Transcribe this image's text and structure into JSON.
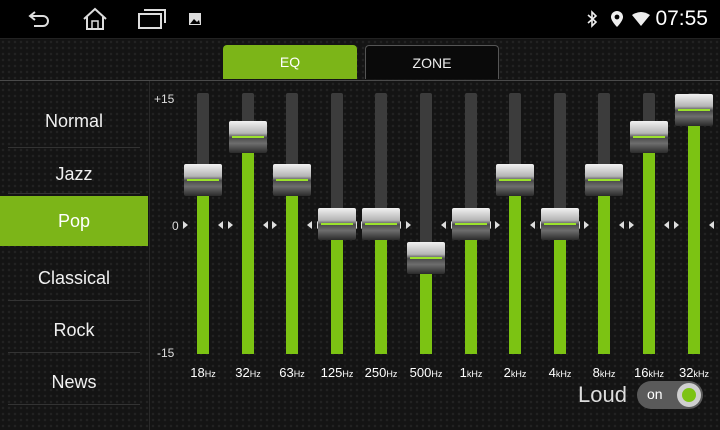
{
  "status_bar": {
    "time": "07:55",
    "nav_icons": [
      "back-icon",
      "home-icon",
      "recent-apps-icon",
      "image-notification-icon"
    ],
    "status_icons": [
      "bluetooth-icon",
      "location-icon",
      "wifi-icon"
    ]
  },
  "tabs": [
    {
      "label": "EQ",
      "selected": true
    },
    {
      "label": "ZONE",
      "selected": false
    }
  ],
  "presets": [
    {
      "label": "Normal",
      "selected": false
    },
    {
      "label": "Jazz",
      "selected": false
    },
    {
      "label": "Pop",
      "selected": true
    },
    {
      "label": "Classical",
      "selected": false
    },
    {
      "label": "Rock",
      "selected": false
    },
    {
      "label": "News",
      "selected": false
    }
  ],
  "scale": {
    "max": "+15",
    "zero": "0",
    "min": "-15",
    "max_value": 15,
    "min_value": -15
  },
  "bands": [
    {
      "num": "18",
      "unit": "Hz",
      "value": 5
    },
    {
      "num": "32",
      "unit": "Hz",
      "value": 10
    },
    {
      "num": "63",
      "unit": "Hz",
      "value": 5
    },
    {
      "num": "125",
      "unit": "Hz",
      "value": 0
    },
    {
      "num": "250",
      "unit": "Hz",
      "value": 0
    },
    {
      "num": "500",
      "unit": "Hz",
      "value": -4
    },
    {
      "num": "1",
      "unit": "kHz",
      "value": 0
    },
    {
      "num": "2",
      "unit": "kHz",
      "value": 5
    },
    {
      "num": "4",
      "unit": "kHz",
      "value": 0
    },
    {
      "num": "8",
      "unit": "kHz",
      "value": 5
    },
    {
      "num": "16",
      "unit": "kHz",
      "value": 10
    },
    {
      "num": "32",
      "unit": "kHz",
      "value": 13
    }
  ],
  "loud": {
    "label": "Loud",
    "state": "on",
    "enabled": true
  },
  "colors": {
    "accent": "#7cb518",
    "fill": "#7cc313",
    "track": "#3c3c3c",
    "background": "#141414"
  }
}
